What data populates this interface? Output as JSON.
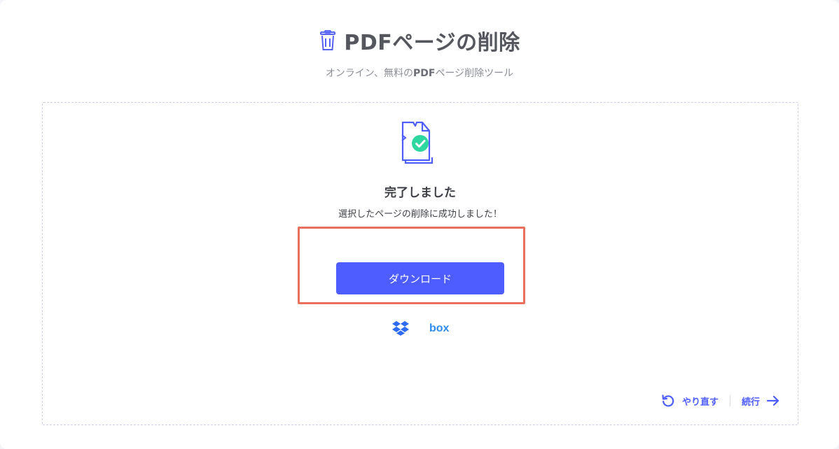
{
  "header": {
    "title": "PDFページの削除",
    "subtitle_prefix": "オンライン、無料の",
    "subtitle_bold": "PDF",
    "subtitle_suffix": "ページ削除ツール"
  },
  "result": {
    "title": "完了しました",
    "message": "選択したページの削除に成功しました！"
  },
  "actions": {
    "download_label": "ダウンロード",
    "redo_label": "やり直す",
    "continue_label": "続行"
  },
  "cloud": {
    "dropbox_icon": "dropbox-icon",
    "box_label": "box"
  },
  "colors": {
    "accent": "#4e5dff",
    "success": "#2ed6a0",
    "highlight": "#e8705d"
  }
}
